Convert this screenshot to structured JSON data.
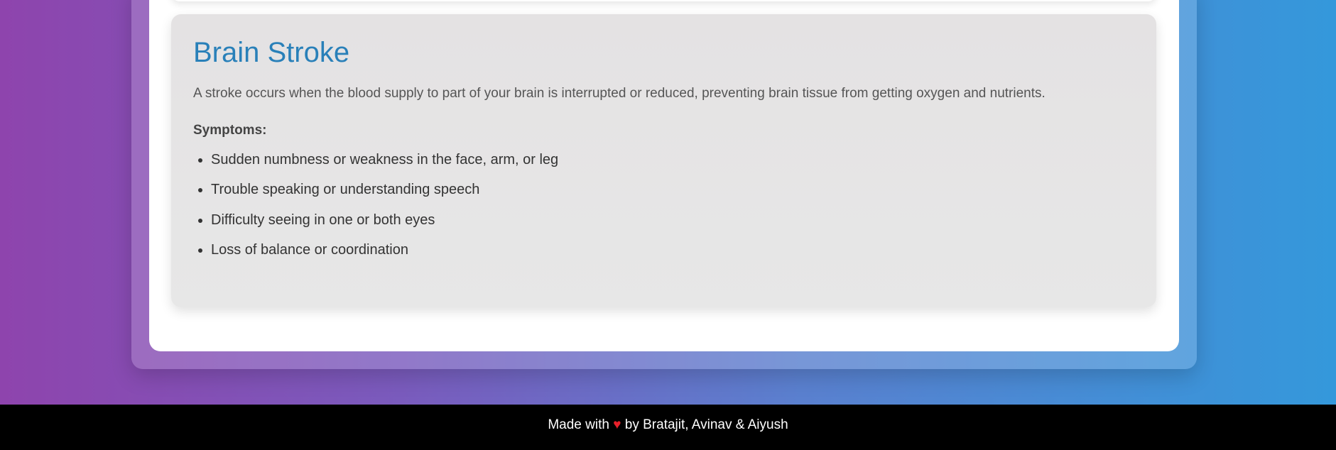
{
  "card": {
    "title": "Brain Stroke",
    "description": "A stroke occurs when the blood supply to part of your brain is interrupted or reduced, preventing brain tissue from getting oxygen and nutrients.",
    "symptoms_heading": "Symptoms:",
    "symptoms": [
      "Sudden numbness or weakness in the face, arm, or leg",
      "Trouble speaking or understanding speech",
      "Difficulty seeing in one or both eyes",
      "Loss of balance or coordination"
    ]
  },
  "footer": {
    "prefix": "Made with",
    "heart": "♥",
    "suffix": "by Bratajit, Avinav & Aiyush"
  },
  "colors": {
    "title": "#2980b9",
    "heart": "#e8202a",
    "gradient_start": "#8e44ad",
    "gradient_end": "#3498db"
  }
}
